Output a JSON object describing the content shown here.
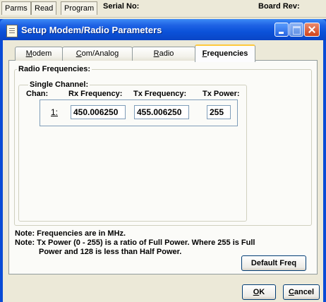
{
  "background_app": {
    "tabs": [
      "Parms",
      "Read",
      "Program"
    ],
    "serial_label": "Serial No:",
    "board_rev_label": "Board Rev:"
  },
  "window": {
    "title": "Setup Modem/Radio Parameters",
    "icons": {
      "app": "notepad-icon",
      "minimize": "minimize-icon",
      "maximize": "maximize-icon",
      "close": "close-icon"
    }
  },
  "tabs": {
    "modem": {
      "prefix": "",
      "accel": "M",
      "rest": "odem"
    },
    "comanalog": {
      "prefix": "",
      "accel": "C",
      "rest": "om/Analog"
    },
    "radio": {
      "prefix": "",
      "accel": "R",
      "rest": "adio"
    },
    "frequencies": {
      "prefix": "",
      "accel": "F",
      "rest": "requencies"
    },
    "active": "Frequencies"
  },
  "radio_frequencies": {
    "group_label": "Radio Frequencies:",
    "single_channel": {
      "group_label": "Single Channel:",
      "headers": {
        "chan": "Chan:",
        "rx": "Rx Frequency:",
        "tx": "Tx Frequency:",
        "power": "Tx Power:"
      },
      "rows": [
        {
          "chan": "1:",
          "rx": "450.006250",
          "tx": "455.006250",
          "power": "255"
        }
      ]
    }
  },
  "notes": {
    "note1": "Note: Frequencies are in MHz.",
    "note2_line1": "Note: Tx Power (0 - 255) is a ratio of Full Power.  Where 255 is Full",
    "note2_line2": "Power and 128 is less than Half Power."
  },
  "buttons": {
    "default_freq": "Default Freq",
    "ok": {
      "accel": "O",
      "rest": "K"
    },
    "cancel": {
      "accel": "C",
      "rest": "ancel"
    }
  },
  "colors": {
    "titlebar": "#0a52d9",
    "face": "#ece9d8",
    "active_tab_highlight": "#ffc83c",
    "close_button": "#d1431b"
  }
}
